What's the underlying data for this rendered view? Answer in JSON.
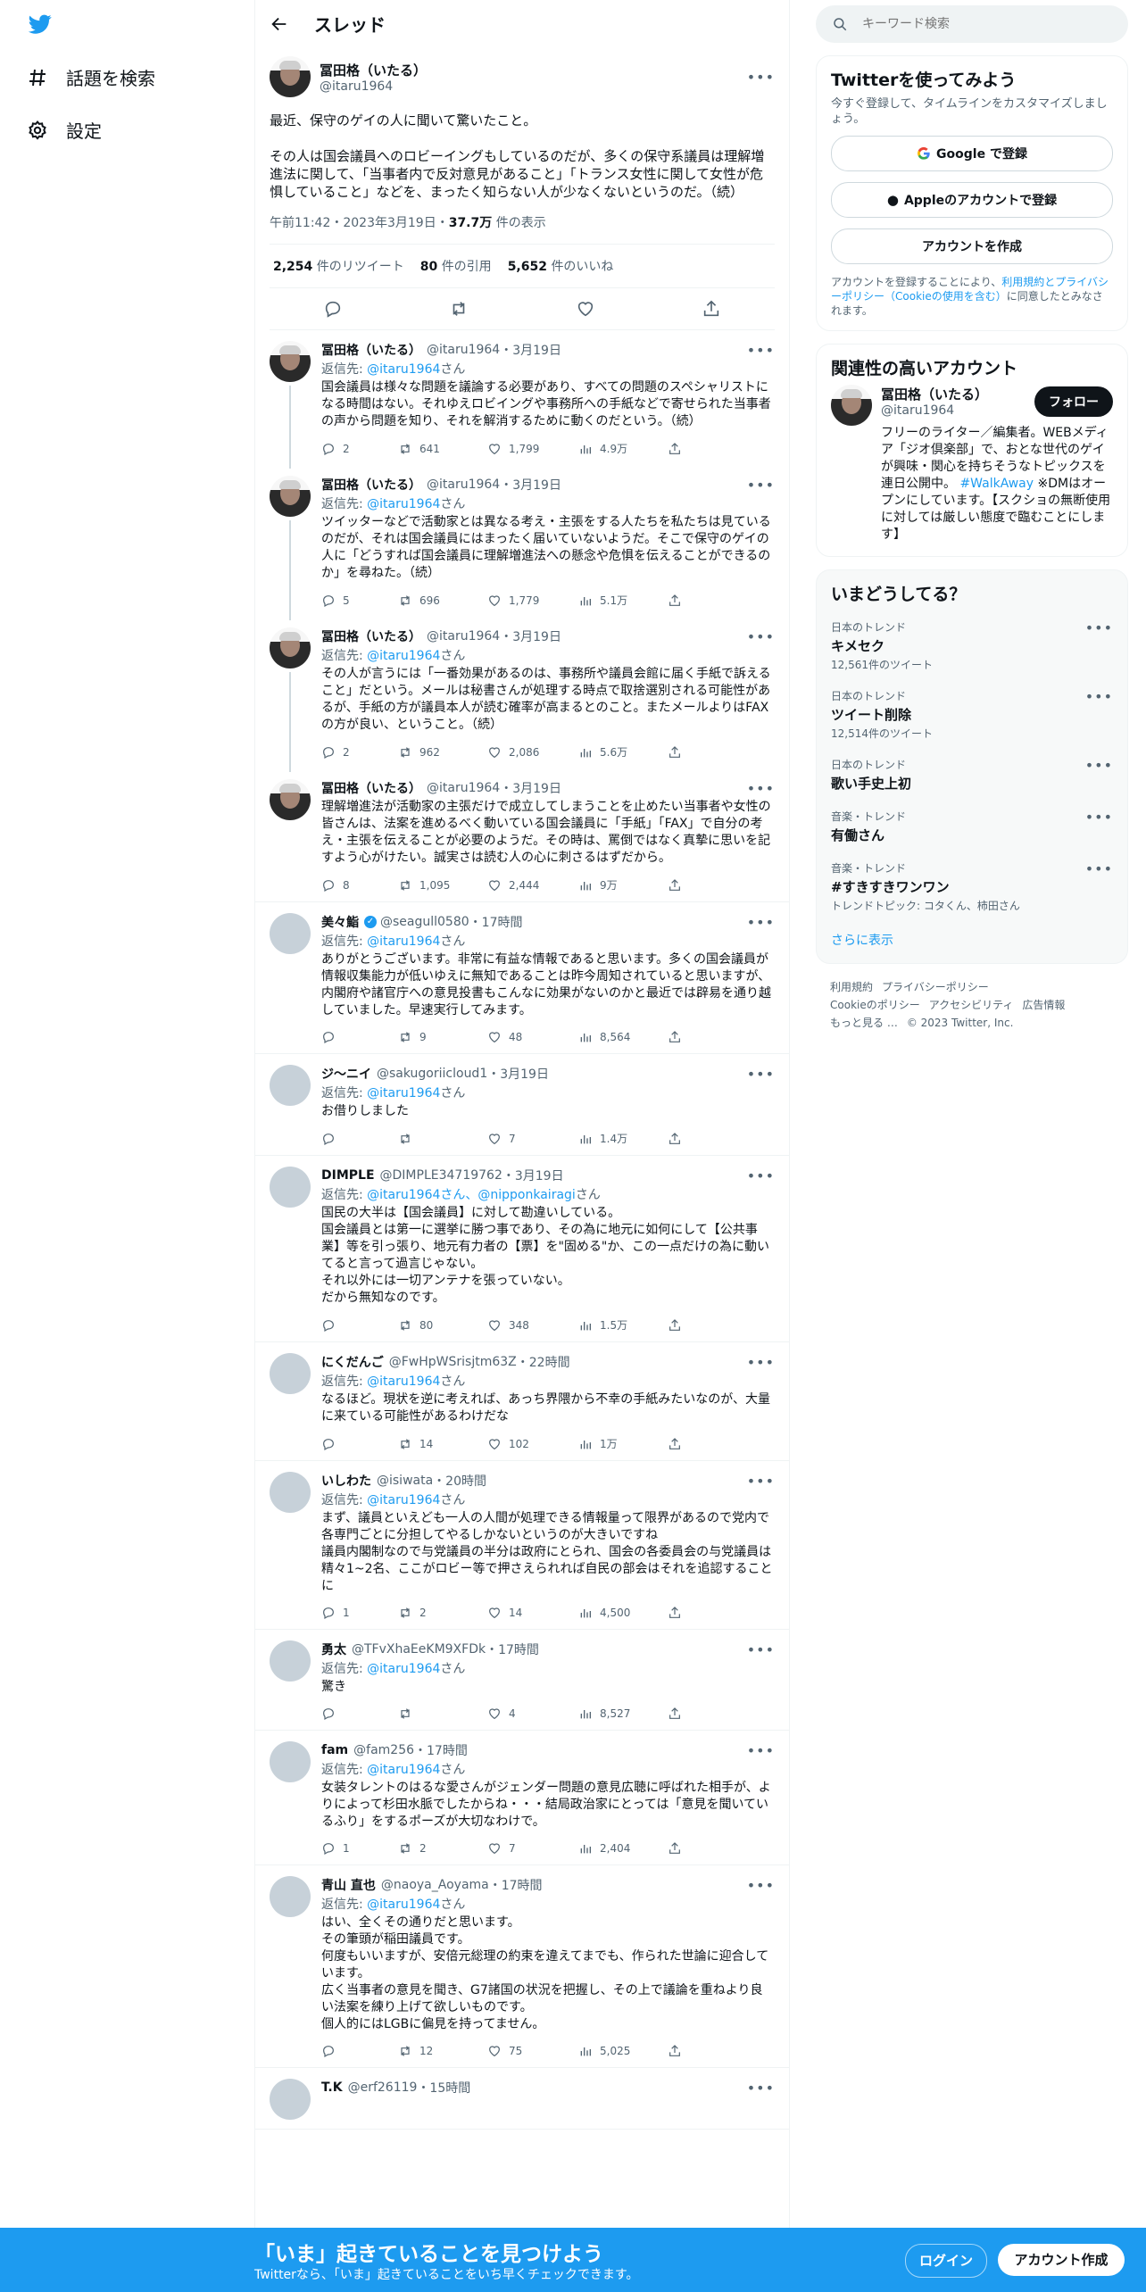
{
  "nav": {
    "explore": "話題を検索",
    "settings": "設定"
  },
  "header": {
    "title": "スレッド"
  },
  "focal": {
    "name": "冨田格（いたる）",
    "handle": "@itaru1964",
    "text": "最近、保守のゲイの人に聞いて驚いたこと。\n\nその人は国会議員へのロビーイングもしているのだが、多くの保守系議員は理解増進法に関して、「当事者内で反対意見があること」「トランス女性に関して女性が危惧していること」などを、まったく知らない人が少なくないというのだ。（続）",
    "time": "午前11:42・2023年3月19日・",
    "views": "37.7万",
    "views_label": "件の表示",
    "retweets": "2,254",
    "retweets_label": "件のリツイート",
    "quotes": "80",
    "quotes_label": "件の引用",
    "likes": "5,652",
    "likes_label": "件のいいね"
  },
  "replies": [
    {
      "name": "冨田格（いたる）",
      "handle": "@itaru1964",
      "date": "・3月19日",
      "reply_to": "@itaru1964",
      "reply_suffix": "さん",
      "text": "国会議員は様々な問題を議論する必要があり、すべての問題のスペシャリストになる時間はない。それゆえロビイングや事務所への手紙などで寄せられた当事者の声から問題を知り、それを解消するために動くのだという。（続）",
      "replies": "2",
      "retweets": "641",
      "likes": "1,799",
      "views": "4.9万"
    },
    {
      "name": "冨田格（いたる）",
      "handle": "@itaru1964",
      "date": "・3月19日",
      "reply_to": "@itaru1964",
      "reply_suffix": "さん",
      "text": "ツイッターなどで活動家とは異なる考え・主張をする人たちを私たちは見ているのだが、それは国会議員にはまったく届いていないようだ。そこで保守のゲイの人に「どうすれば国会議員に理解増進法への懸念や危惧を伝えることができるのか」を尋ねた。（続）",
      "replies": "5",
      "retweets": "696",
      "likes": "1,779",
      "views": "5.1万"
    },
    {
      "name": "冨田格（いたる）",
      "handle": "@itaru1964",
      "date": "・3月19日",
      "reply_to": "@itaru1964",
      "reply_suffix": "さん",
      "text": "その人が言うには「一番効果があるのは、事務所や議員会館に届く手紙で訴えること」だという。メールは秘書さんが処理する時点で取捨選別される可能性があるが、手紙の方が議員本人が読む確率が高まるとのこと。またメールよりはFAXの方が良い、ということ。（続）",
      "replies": "2",
      "retweets": "962",
      "likes": "2,086",
      "views": "5.6万"
    },
    {
      "name": "冨田格（いたる）",
      "handle": "@itaru1964",
      "date": "・3月19日",
      "reply_to": "",
      "reply_suffix": "",
      "text": "理解増進法が活動家の主張だけで成立してしまうことを止めたい当事者や女性の皆さんは、法案を進めるべく動いている国会議員に「手紙」「FAX」で自分の考え・主張を伝えることが必要のようだ。その時は、罵倒ではなく真摯に思いを記すよう心がけたい。誠実さは読む人の心に刺さるはずだから。",
      "replies": "8",
      "retweets": "1,095",
      "likes": "2,444",
      "views": "9万"
    },
    {
      "name": "美々鮨",
      "handle": "@seagull0580",
      "date": "・17時間",
      "reply_to": "@itaru1964",
      "reply_suffix": "さん",
      "text": "ありがとうございます。非常に有益な情報であると思います。多くの国会議員が情報収集能力が低いゆえに無知であることは昨今周知されていると思いますが、内閣府や諸官庁への意見投書もこんなに効果がないのかと最近では辟易を通り越していました。早速実行してみます。",
      "replies": "",
      "retweets": "9",
      "likes": "48",
      "views": "8,564"
    },
    {
      "name": "ジ〜ニイ",
      "handle": "@sakugoriicloud1",
      "date": "・3月19日",
      "reply_to": "@itaru1964",
      "reply_suffix": "さん",
      "text": "お借りしました",
      "replies": "",
      "retweets": "",
      "likes": "7",
      "views": "1.4万"
    },
    {
      "name": "DIMPLE",
      "handle": "@DIMPLE34719762",
      "date": "・3月19日",
      "reply_to": "@itaru1964",
      "reply_to2": "@nipponkairagi",
      "reply_suffix": "さん",
      "text": "国民の大半は【国会議員】に対して勘違いしている。\n国会議員とは第一に選挙に勝つ事であり、その為に地元に如何にして【公共事業】等を引っ張り、地元有力者の【票】を\"固める\"か、この一点だけの為に動いてると言って過言じゃない。\nそれ以外には一切アンテナを張っていない。\nだから無知なのです。",
      "replies": "",
      "retweets": "80",
      "likes": "348",
      "views": "1.5万"
    },
    {
      "name": "にくだんご",
      "handle": "@FwHpWSrisjtm63Z",
      "date": "・22時間",
      "reply_to": "@itaru1964",
      "reply_suffix": "さん",
      "text": "なるほど。現状を逆に考えれば、あっち界隈から不幸の手紙みたいなのが、大量に来ている可能性があるわけだな",
      "replies": "",
      "retweets": "14",
      "likes": "102",
      "views": "1万"
    },
    {
      "name": "いしわた",
      "handle": "@isiwata",
      "date": "・20時間",
      "reply_to": "@itaru1964",
      "reply_suffix": "さん",
      "text": "まず、議員といえども一人の人間が処理できる情報量って限界があるので党内で各専門ごとに分担してやるしかないというのが大きいですね\n議員内閣制なので与党議員の半分は政府にとられ、国会の各委員会の与党議員は精々1~2名、ここがロビー等で押さえられれば自民の部会はそれを追認することに",
      "replies": "1",
      "retweets": "2",
      "likes": "14",
      "views": "4,500"
    },
    {
      "name": "勇太",
      "handle": "@TFvXhaEeKM9XFDk",
      "date": "・17時間",
      "reply_to": "@itaru1964",
      "reply_suffix": "さん",
      "text": "驚き",
      "replies": "",
      "retweets": "",
      "likes": "4",
      "views": "8,527"
    },
    {
      "name": "fam",
      "handle": "@fam256",
      "date": "・17時間",
      "reply_to": "@itaru1964",
      "reply_suffix": "さん",
      "text": "女装タレントのはるな愛さんがジェンダー問題の意見広聴に呼ばれた相手が、よりによって杉田水脈でしたからね・・・結局政治家にとっては「意見を聞いているふり」をするポーズが大切なわけで。",
      "replies": "1",
      "retweets": "2",
      "likes": "7",
      "views": "2,404"
    },
    {
      "name": "青山 直也",
      "handle": "@naoya_Aoyama",
      "date": "・17時間",
      "reply_to": "@itaru1964",
      "reply_suffix": "さん",
      "text": "はい、全くその通りだと思います。\nその筆頭が稲田議員です。\n何度もいいますが、安倍元総理の約束を違えてまでも、作られた世論に迎合しています。\n広く当事者の意見を聞き、G7諸国の状況を把握し、その上で議論を重ねより良い法案を練り上げて欲しいものです。\n個人的にはLGBに偏見を持ってません。",
      "replies": "",
      "retweets": "12",
      "likes": "75",
      "views": "5,025"
    },
    {
      "name": "T.K",
      "handle": "@erf26119",
      "date": "・15時間",
      "reply_to": "",
      "reply_suffix": "",
      "text": "",
      "replies": "",
      "retweets": "",
      "likes": "",
      "views": ""
    }
  ],
  "search": {
    "placeholder": "キーワード検索"
  },
  "signup_card": {
    "title": "Twitterを使ってみよう",
    "subtitle": "今すぐ登録して、タイムラインをカスタマイズしましょう。",
    "google": "Google で登録",
    "apple": "Appleのアカウントで登録",
    "create": "アカウントを作成",
    "terms_pre": "アカウントを登録することにより、",
    "terms_link": "利用規約とプライバシーポリシー（Cookieの使用を含む）",
    "terms_post": "に同意したとみなされます。"
  },
  "related": {
    "title": "関連性の高いアカウント",
    "name": "冨田格（いたる）",
    "handle": "@itaru1964",
    "follow": "フォロー",
    "bio_pre": "フリーのライター／編集者。WEBメディア「ジオ倶楽部」で、おとな世代のゲイが興味・関心を持ちそうなトピックスを連日公開中。",
    "bio_tag": "#WalkAway",
    "bio_post": "※DMはオープンにしています。【スクショの無断使用に対しては厳しい態度で臨むことにします】"
  },
  "trends": {
    "title": "いまどうしてる？",
    "items": [
      {
        "category": "日本のトレンド",
        "name": "キメセク",
        "count": "12,561件のツイート"
      },
      {
        "category": "日本のトレンド",
        "name": "ツイート削除",
        "count": "12,514件のツイート"
      },
      {
        "category": "日本のトレンド",
        "name": "歌い手史上初",
        "count": ""
      },
      {
        "category": "音楽・トレンド",
        "name": "有働さん",
        "count": ""
      },
      {
        "category": "音楽・トレンド",
        "name": "#すきすきワンワン",
        "count": "トレンドトピック: コタくん、柿田さん"
      }
    ],
    "show_more": "さらに表示"
  },
  "footer": {
    "terms": "利用規約",
    "privacy": "プライバシーポリシー",
    "cookie": "Cookieのポリシー",
    "accessibility": "アクセシビリティ",
    "ads": "広告情報",
    "more": "もっと見る …",
    "copyright": "© 2023 Twitter, Inc."
  },
  "bottom_bar": {
    "title": "「いま」起きていることを見つけよう",
    "subtitle": "Twitterなら、「いま」起きていることをいち早くチェックできます。",
    "login": "ログイン",
    "signup": "アカウント作成"
  },
  "colors": {
    "accent": "#1d9bf0",
    "text": "#0f1419",
    "secondary": "#536471"
  }
}
